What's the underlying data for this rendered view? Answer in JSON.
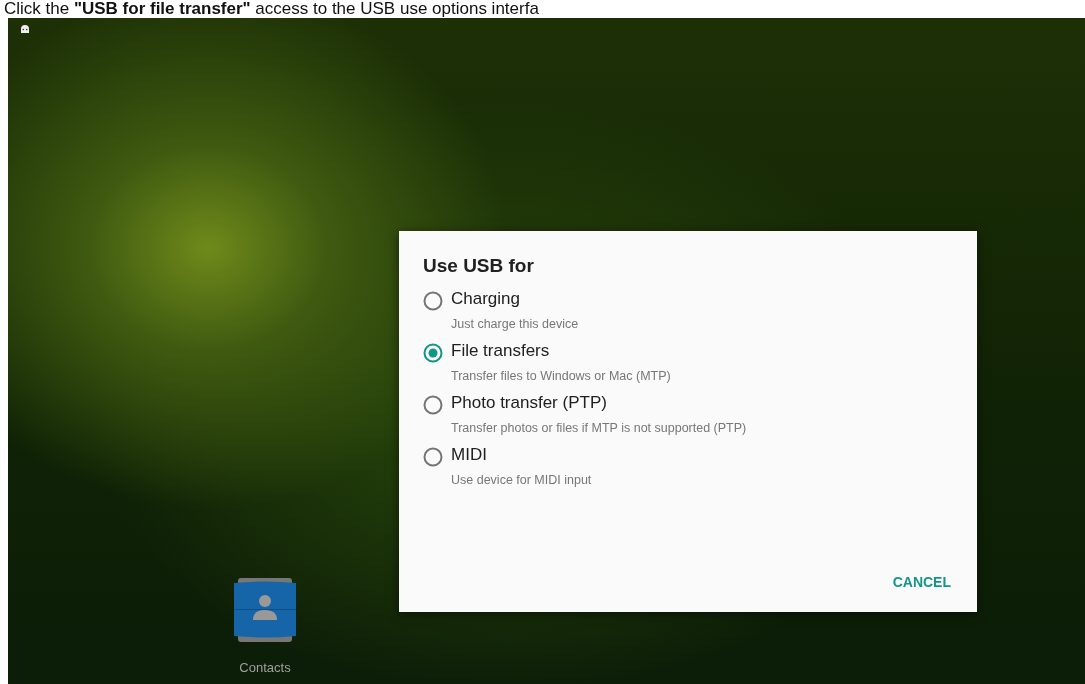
{
  "caption": "Click the **\"USB for file transfer\"** access to the USB use options interfa",
  "home": {
    "apps": [
      {
        "label": "Contacts"
      }
    ]
  },
  "dialog": {
    "title": "Use USB for",
    "options": [
      {
        "label": "Charging",
        "description": "Just charge this device",
        "selected": false
      },
      {
        "label": "File transfers",
        "description": "Transfer files to Windows or Mac (MTP)",
        "selected": true
      },
      {
        "label": "Photo transfer (PTP)",
        "description": "Transfer photos or files if MTP is not supported (PTP)",
        "selected": false
      },
      {
        "label": "MIDI",
        "description": "Use device for MIDI input",
        "selected": false
      }
    ],
    "buttons": [
      "CANCEL"
    ]
  }
}
